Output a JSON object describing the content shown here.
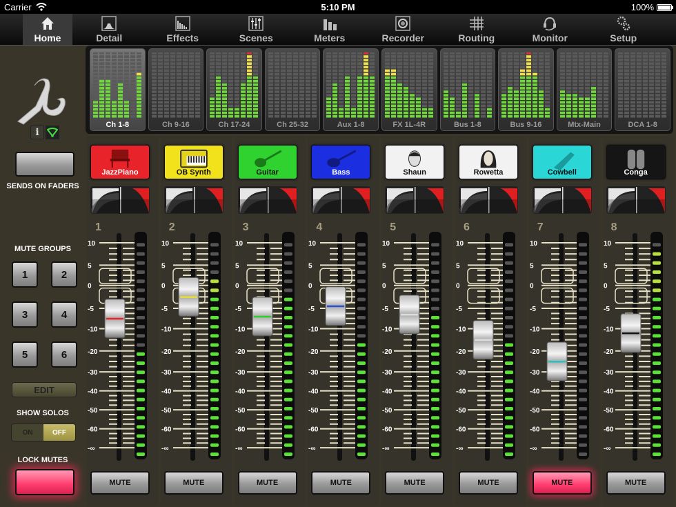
{
  "status_bar": {
    "carrier": "Carrier",
    "time": "5:10 PM",
    "battery": "100%"
  },
  "tabs": [
    {
      "label": "Home",
      "icon": "home-icon",
      "active": true
    },
    {
      "label": "Detail",
      "icon": "detail-icon",
      "active": false
    },
    {
      "label": "Effects",
      "icon": "effects-icon",
      "active": false
    },
    {
      "label": "Scenes",
      "icon": "scenes-icon",
      "active": false
    },
    {
      "label": "Meters",
      "icon": "meters-icon",
      "active": false
    },
    {
      "label": "Recorder",
      "icon": "recorder-icon",
      "active": false
    },
    {
      "label": "Routing",
      "icon": "routing-icon",
      "active": false
    },
    {
      "label": "Monitor",
      "icon": "monitor-icon",
      "active": false
    },
    {
      "label": "Setup",
      "icon": "setup-icon",
      "active": false
    }
  ],
  "sidebar": {
    "info_label": "i",
    "sends_on_faders_label": "SENDS ON FADERS",
    "mute_groups_label": "MUTE GROUPS",
    "mute_groups": [
      "1",
      "2",
      "3",
      "4",
      "5",
      "6"
    ],
    "edit_label": "EDIT",
    "show_solos_label": "SHOW SOLOS",
    "show_solos_on": "ON",
    "show_solos_off": "OFF",
    "show_solos_state": "OFF",
    "lock_mutes_label": "LOCK MUTES",
    "lock_mutes_active": true
  },
  "banks": [
    {
      "name": "Ch 1-8",
      "selected": true,
      "levels": [
        0.27,
        0.6,
        0.6,
        0.27,
        0.5,
        0.27,
        0,
        0.68
      ],
      "peak": [
        0,
        0,
        0,
        0,
        0,
        0,
        0,
        0
      ]
    },
    {
      "name": "Ch 9-16",
      "selected": false,
      "levels": [
        0,
        0,
        0,
        0,
        0,
        0,
        0,
        0
      ],
      "peak": [
        0,
        0,
        0,
        0,
        0,
        0,
        0,
        0
      ]
    },
    {
      "name": "Ch 17-24",
      "selected": false,
      "levels": [
        0.32,
        0.63,
        0.5,
        0.18,
        0.18,
        0.53,
        0.97,
        0.63
      ],
      "peak": [
        0,
        0,
        0,
        0,
        0,
        0,
        1,
        0
      ]
    },
    {
      "name": "Ch 25-32",
      "selected": false,
      "levels": [
        0,
        0,
        0,
        0,
        0,
        0,
        0,
        0
      ],
      "peak": [
        0,
        0,
        0,
        0,
        0,
        0,
        0,
        0
      ]
    },
    {
      "name": "Aux 1-8",
      "selected": false,
      "levels": [
        0.32,
        0.53,
        0.18,
        0.63,
        0.18,
        0.63,
        0.97,
        0.63
      ],
      "peak": [
        0,
        0,
        0,
        0,
        0,
        0,
        1,
        0
      ]
    },
    {
      "name": "FX 1L-4R",
      "selected": false,
      "levels": [
        0.72,
        0.72,
        0.53,
        0.48,
        0.37,
        0.32,
        0.18,
        0.18
      ],
      "peak": [
        0,
        0,
        0,
        0,
        0,
        0,
        0,
        0
      ]
    },
    {
      "name": "Bus 1-8",
      "selected": false,
      "levels": [
        0.42,
        0.32,
        0.1,
        0.53,
        0,
        0.37,
        0,
        0.18
      ],
      "peak": [
        0,
        0,
        0,
        0,
        0,
        0,
        0,
        0
      ]
    },
    {
      "name": "Bus 9-16",
      "selected": false,
      "levels": [
        0.37,
        0.48,
        0.42,
        0.72,
        0.97,
        0.68,
        0.42,
        0.18
      ],
      "peak": [
        0,
        0,
        0,
        0,
        1,
        0,
        0,
        0
      ]
    },
    {
      "name": "Mtx-Main",
      "selected": false,
      "levels": [
        0.42,
        0.37,
        0.37,
        0.32,
        0.32,
        0.48,
        0,
        0
      ],
      "peak": [
        0,
        0,
        0,
        0,
        0,
        0,
        0,
        0
      ]
    },
    {
      "name": "DCA 1-8",
      "selected": false,
      "levels": [
        0,
        0,
        0,
        0,
        0,
        0,
        0,
        0
      ],
      "peak": [
        0,
        0,
        0,
        0,
        0,
        0,
        0,
        0
      ]
    }
  ],
  "scale_labels": [
    "10",
    "5",
    "0",
    "-5",
    "-10",
    "-20",
    "-30",
    "-40",
    "-50",
    "-60",
    "-∞"
  ],
  "channels": [
    {
      "number": "1",
      "name": "JazzPiano",
      "color": "#e8232a",
      "icon": "piano-icon",
      "text_color": "#ffffff",
      "fader_db": -7.5,
      "fader_line": "#e8232a",
      "meter_segments_lit": 12,
      "mute_label": "MUTE",
      "muted": false
    },
    {
      "number": "2",
      "name": "OB Synth",
      "color": "#f2e21c",
      "icon": "synth-icon",
      "text_color": "#111111",
      "fader_db": -2.5,
      "fader_line": "#e6e030",
      "meter_segments_lit": 20,
      "mute_label": "MUTE",
      "muted": false
    },
    {
      "number": "3",
      "name": "Guitar",
      "color": "#2fd22f",
      "icon": "guitar-icon",
      "text_color": "#111111",
      "fader_db": -7,
      "fader_line": "#2fcf2f",
      "meter_segments_lit": 18,
      "mute_label": "MUTE",
      "muted": false
    },
    {
      "number": "4",
      "name": "Bass",
      "color": "#1c2fe0",
      "icon": "bass-guitar-icon",
      "text_color": "#ffffff",
      "fader_db": -4.5,
      "fader_line": "#2a4fd0",
      "meter_segments_lit": 13,
      "mute_label": "MUTE",
      "muted": false
    },
    {
      "number": "5",
      "name": "Shaun",
      "color": "#f2f2f2",
      "icon": "person-male-icon",
      "text_color": "#111111",
      "fader_db": -6.5,
      "fader_line": "#dddddd",
      "meter_segments_lit": 16,
      "mute_label": "MUTE",
      "muted": false
    },
    {
      "number": "6",
      "name": "Rowetta",
      "color": "#f2f2f2",
      "icon": "person-female-icon",
      "text_color": "#111111",
      "fader_db": -15,
      "fader_line": "#dddddd",
      "meter_segments_lit": 13,
      "mute_label": "MUTE",
      "muted": false
    },
    {
      "number": "7",
      "name": "Cowbell",
      "color": "#2bd6d6",
      "icon": "cowbell-icon",
      "text_color": "#111111",
      "fader_db": -25,
      "fader_line": "#2bbfbf",
      "meter_segments_lit": 0,
      "mute_label": "MUTE",
      "muted": true
    },
    {
      "number": "8",
      "name": "Conga",
      "color": "#151515",
      "icon": "conga-icon",
      "text_color": "#ffffff",
      "fader_db": -12,
      "fader_line": "#111111",
      "meter_segments_lit": 23,
      "mute_label": "MUTE",
      "muted": false
    }
  ]
}
